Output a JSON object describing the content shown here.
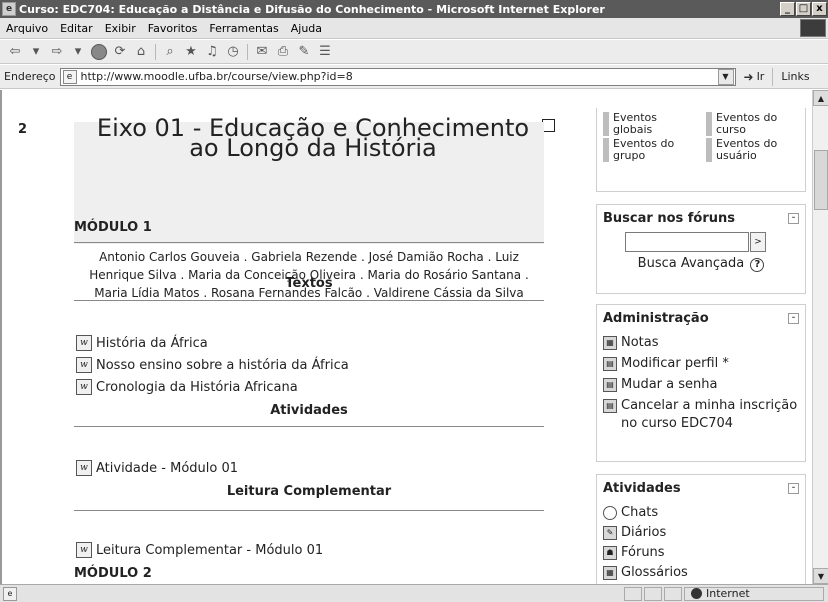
{
  "window": {
    "title": "Curso: EDC704: Educação a Distância e Difusão do Conhecimento - Microsoft Internet Explorer",
    "minimize": "_",
    "maximize": "□",
    "close": "x"
  },
  "menubar": {
    "items": [
      "Arquivo",
      "Editar",
      "Exibir",
      "Favoritos",
      "Ferramentas",
      "Ajuda"
    ]
  },
  "addressbar": {
    "label": "Endereço",
    "url": "http://www.moodle.ufba.br/course/view.php?id=8",
    "go_label": "Ir",
    "links_label": "Links"
  },
  "main": {
    "section_number": "2",
    "heading": "Eixo 01 - Educação e Conhecimento ao Longo da História",
    "authors": "Antonio Carlos Gouveia . Gabriela Rezende . José Damião Rocha . Luiz Henrique Silva . Maria da Conceição Oliveira . Maria do Rosário Santana . Maria Lídia Matos . Rosana Fernandes Falcão . Valdirene Cássia da Silva",
    "module1_title": "MÓDULO 1",
    "textos_title": "Textos",
    "textos": [
      "História da África",
      "Nosso ensino sobre a história da África",
      "Cronologia da História Africana"
    ],
    "atividades_title": "Atividades",
    "atividades": [
      "Atividade - Módulo 01"
    ],
    "leitura_title": "Leitura Complementar",
    "leitura": [
      "Leitura Complementar - Módulo 01"
    ],
    "module2_title": "MÓDULO 2"
  },
  "sidebar": {
    "events": [
      "Eventos globais",
      "Eventos do curso",
      "Eventos do grupo",
      "Eventos do usuário"
    ],
    "search_block": {
      "title": "Buscar nos fóruns",
      "go": ">",
      "advanced": "Busca Avançada",
      "help": "?"
    },
    "admin_block": {
      "title": "Administração",
      "items": [
        "Notas",
        "Modificar perfil *",
        "Mudar a senha",
        "Cancelar a minha inscrição no curso EDC704"
      ]
    },
    "activities_block": {
      "title": "Atividades",
      "items": [
        "Chats",
        "Diários",
        "Fóruns",
        "Glossários"
      ]
    },
    "toggle": "-"
  },
  "statusbar": {
    "zone": "Internet"
  }
}
